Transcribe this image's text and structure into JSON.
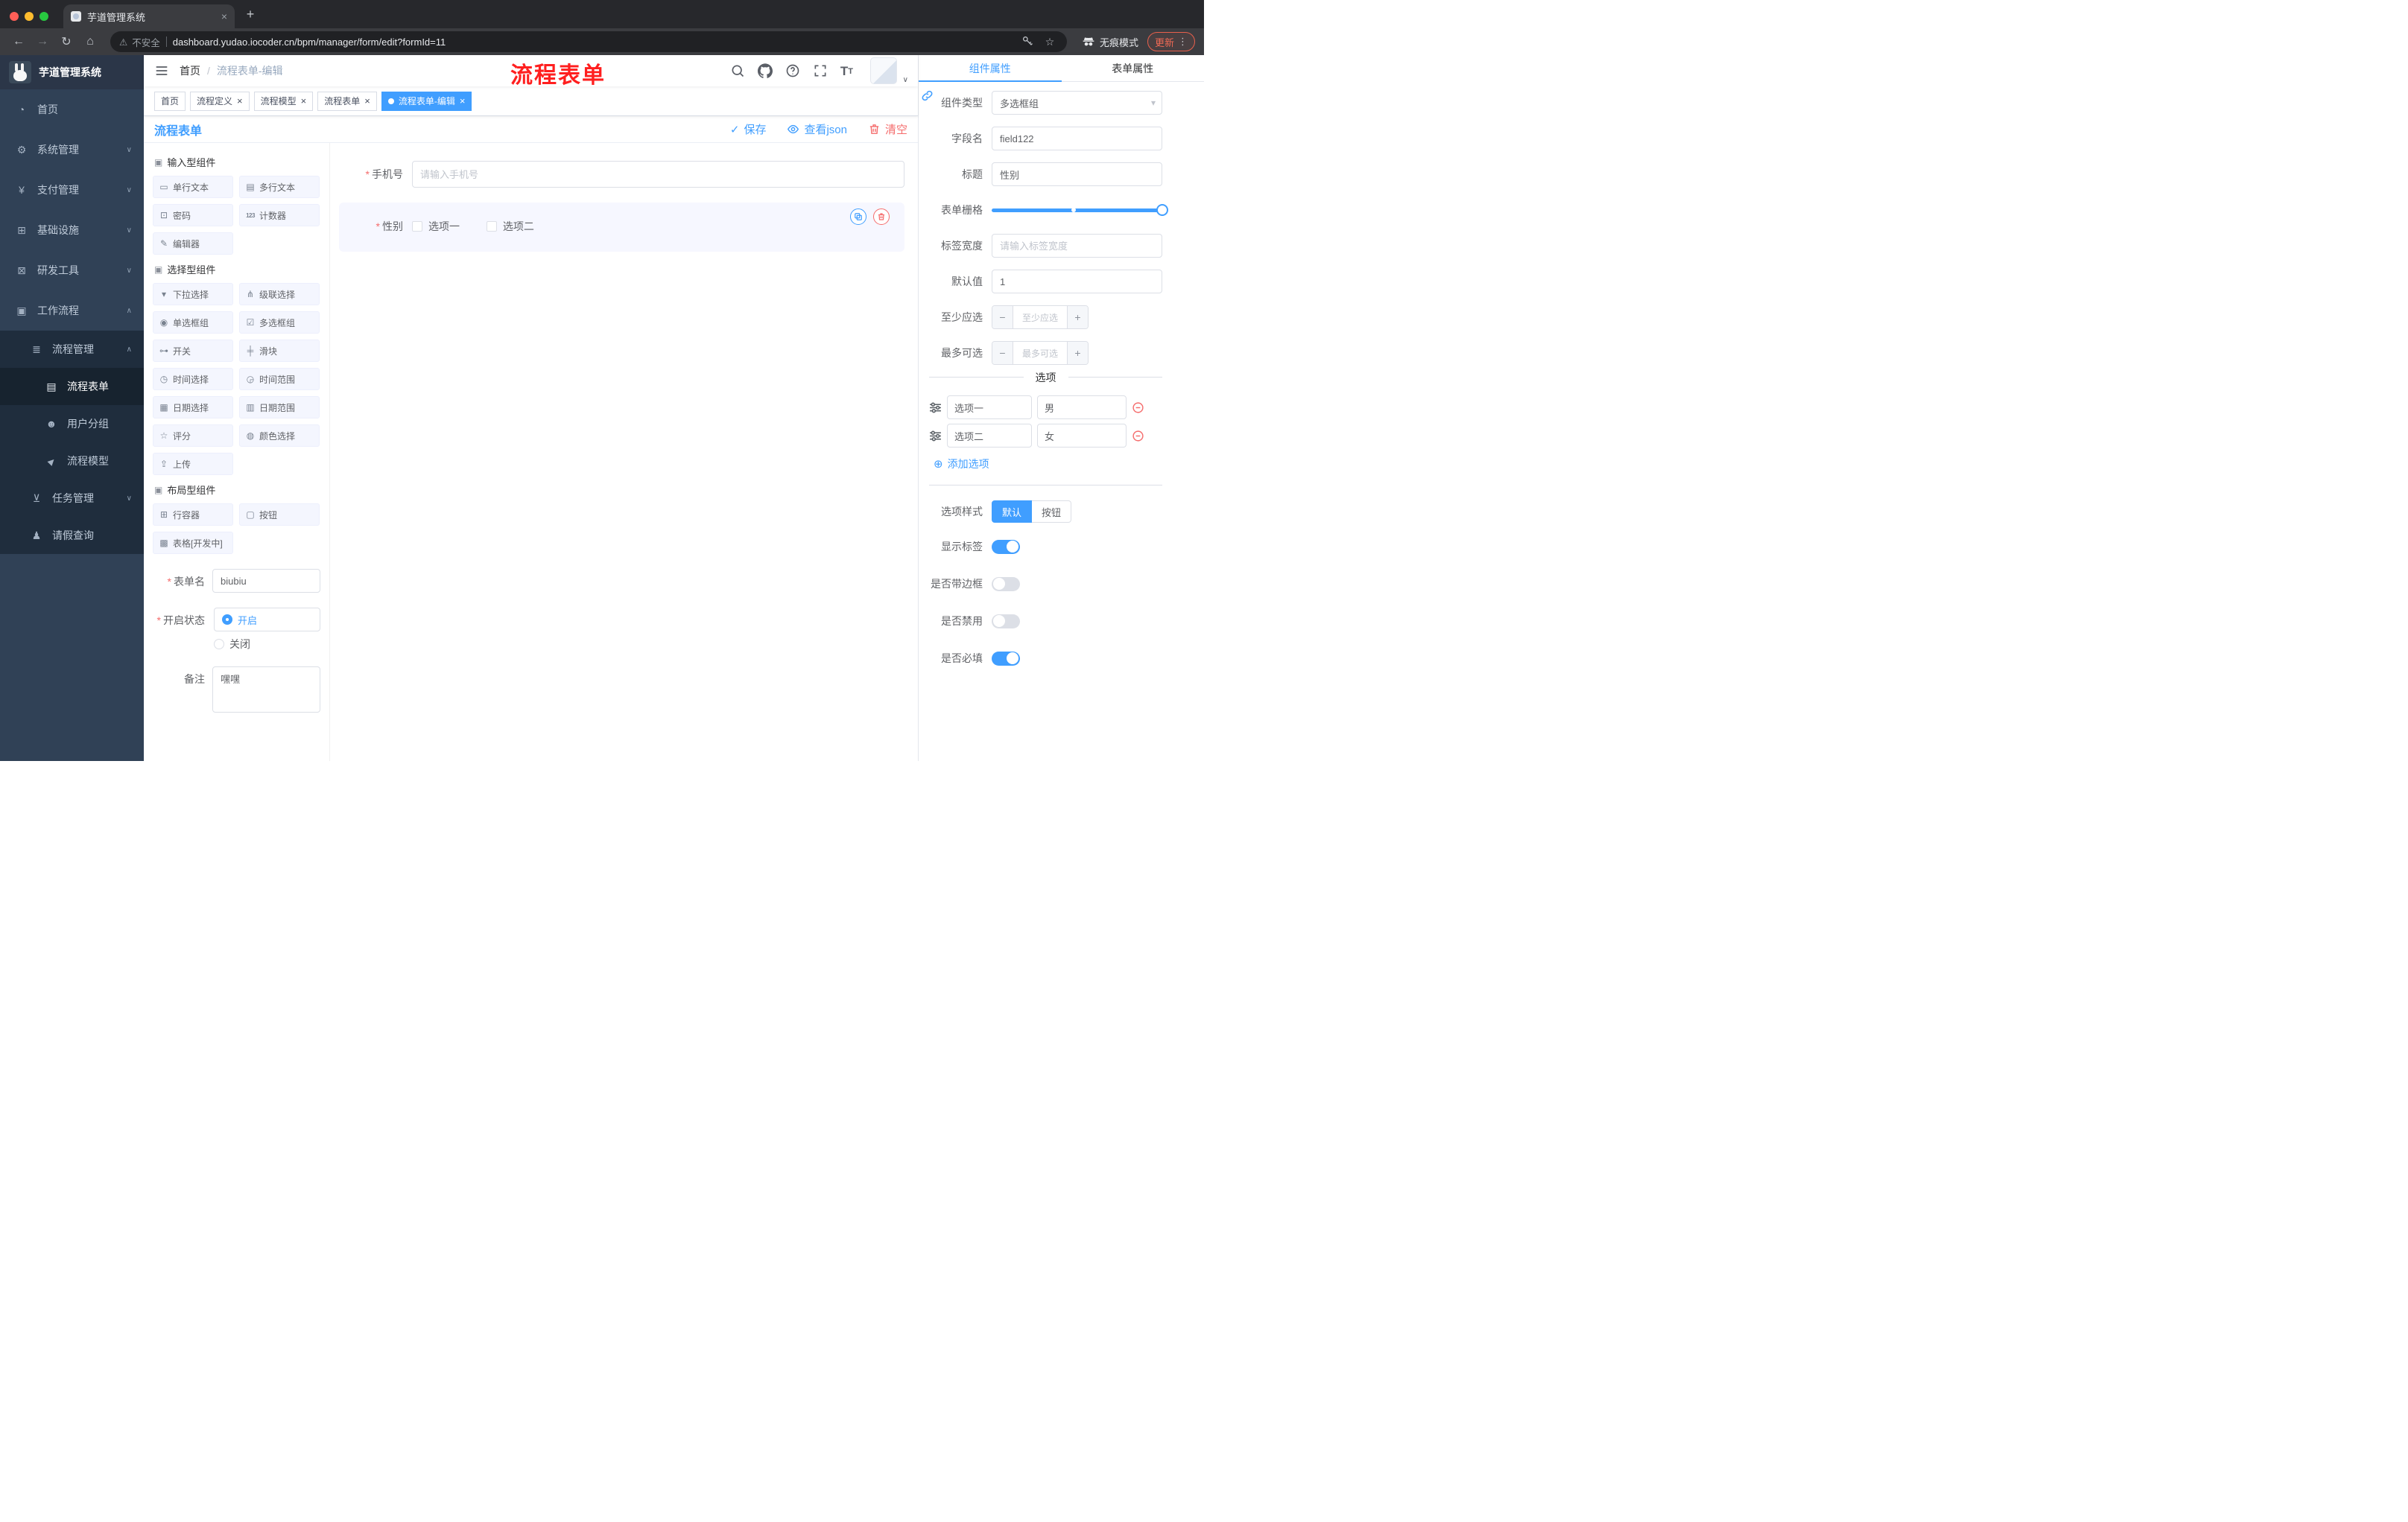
{
  "colors": {
    "accent": "#409eff",
    "danger": "#f56c6c",
    "annotation": "#ff1f1f",
    "sidebar_bg": "#304156"
  },
  "icons": {
    "back": "←",
    "forward": "→",
    "reload": "↻",
    "home": "⌂",
    "warning": "⚠",
    "star": "☆",
    "dots": "⋮",
    "close": "×",
    "plus": "+",
    "caret_down": "∨",
    "caret_up": "∧",
    "select_caret": "▾",
    "check": "✓",
    "minus": "−",
    "circle_plus": "⊕",
    "menu_dashboard": "◔",
    "menu_system": "⚙",
    "menu_payment": "¥",
    "menu_infra": "⊞",
    "menu_devtools": "⊠",
    "menu_workflow": "▣",
    "menu_process_mgmt": "≣",
    "menu_form": "▤",
    "menu_user_group": "☻",
    "menu_process_model": "▶",
    "menu_task": "⊻",
    "menu_leave": "♟",
    "sec_box": "▣",
    "comp_single_text": "▭",
    "comp_multi_text": "▤",
    "comp_password": "⊡",
    "comp_counter": "123",
    "comp_editor": "✎",
    "comp_select": "▾",
    "comp_cascader": "⋔",
    "comp_radio": "◉",
    "comp_checkbox": "☑",
    "comp_switch": "⊶",
    "comp_slider": "╪",
    "comp_time": "◷",
    "comp_time_range": "◶",
    "comp_date": "▦",
    "comp_date_range": "▥",
    "comp_rate": "☆",
    "comp_color": "◍",
    "comp_upload": "⇪",
    "comp_row": "⊞",
    "comp_button": "▢",
    "comp_table": "▩",
    "size_big": "T",
    "size_small": "T"
  },
  "misc": {
    "required": "*"
  },
  "browser": {
    "tab_title": "芋道管理系统",
    "security_label": "不安全",
    "url": "dashboard.yudao.iocoder.cn/bpm/manager/form/edit?formId=11",
    "incognito_label": "无痕模式",
    "update_label": "更新"
  },
  "header": {
    "breadcrumb_home": "首页",
    "breadcrumb_sep": "/",
    "breadcrumb_current": "流程表单-编辑",
    "annotation": "流程表单"
  },
  "sidebar": {
    "logo_title": "芋道管理系统",
    "items": [
      {
        "label": "首页"
      },
      {
        "label": "系统管理"
      },
      {
        "label": "支付管理"
      },
      {
        "label": "基础设施"
      },
      {
        "label": "研发工具"
      },
      {
        "label": "工作流程"
      }
    ],
    "process_mgmt": "流程管理",
    "process_children": [
      {
        "label": "流程表单"
      },
      {
        "label": "用户分组"
      },
      {
        "label": "流程模型"
      }
    ],
    "task_mgmt": "任务管理",
    "leave_query": "请假查询"
  },
  "tags": [
    {
      "label": "首页"
    },
    {
      "label": "流程定义"
    },
    {
      "label": "流程模型"
    },
    {
      "label": "流程表单"
    },
    {
      "label": "流程表单-编辑"
    }
  ],
  "designer": {
    "title": "流程表单",
    "save": "保存",
    "view_json": "查看json",
    "clear": "清空"
  },
  "palette": {
    "sections": [
      {
        "title": "输入型组件"
      },
      {
        "title": "选择型组件"
      },
      {
        "title": "布局型组件"
      }
    ],
    "input_items": [
      "单行文本",
      "多行文本",
      "密码",
      "计数器",
      "编辑器"
    ],
    "select_items": [
      "下拉选择",
      "级联选择",
      "单选框组",
      "多选框组",
      "开关",
      "滑块",
      "时间选择",
      "时间范围",
      "日期选择",
      "日期范围",
      "评分",
      "颜色选择",
      "上传"
    ],
    "layout_items": [
      "行容器",
      "按钮",
      "表格[开发中]"
    ],
    "form": {
      "name_label": "表单名",
      "name_value": "biubiu",
      "status_label": "开启状态",
      "status_on": "开启",
      "status_off": "关闭",
      "remark_label": "备注",
      "remark_value": "嘿嘿"
    }
  },
  "canvas": {
    "phone_label": "手机号",
    "phone_placeholder": "请输入手机号",
    "gender_label": "性别",
    "gender_opt1": "选项一",
    "gender_opt2": "选项二"
  },
  "props": {
    "tab_component": "组件属性",
    "tab_form": "表单属性",
    "component_type_label": "组件类型",
    "component_type_value": "多选框组",
    "field_label": "字段名",
    "field_value": "field122",
    "title_label": "标题",
    "title_value": "性别",
    "grid_label": "表单栅格",
    "label_width_label": "标签宽度",
    "label_width_placeholder": "请输入标签宽度",
    "default_label": "默认值",
    "default_value": "1",
    "min_label": "至少应选",
    "min_placeholder": "至少应选",
    "max_label": "最多可选",
    "max_placeholder": "最多可选",
    "options_title": "选项",
    "options": [
      {
        "name": "选项一",
        "value": "男"
      },
      {
        "name": "选项二",
        "value": "女"
      }
    ],
    "add_option": "添加选项",
    "style_label": "选项样式",
    "style_default": "默认",
    "style_button": "按钮",
    "switch_show_label": "显示标签",
    "switch_border": "是否带边框",
    "switch_disabled": "是否禁用",
    "switch_required": "是否必填"
  }
}
